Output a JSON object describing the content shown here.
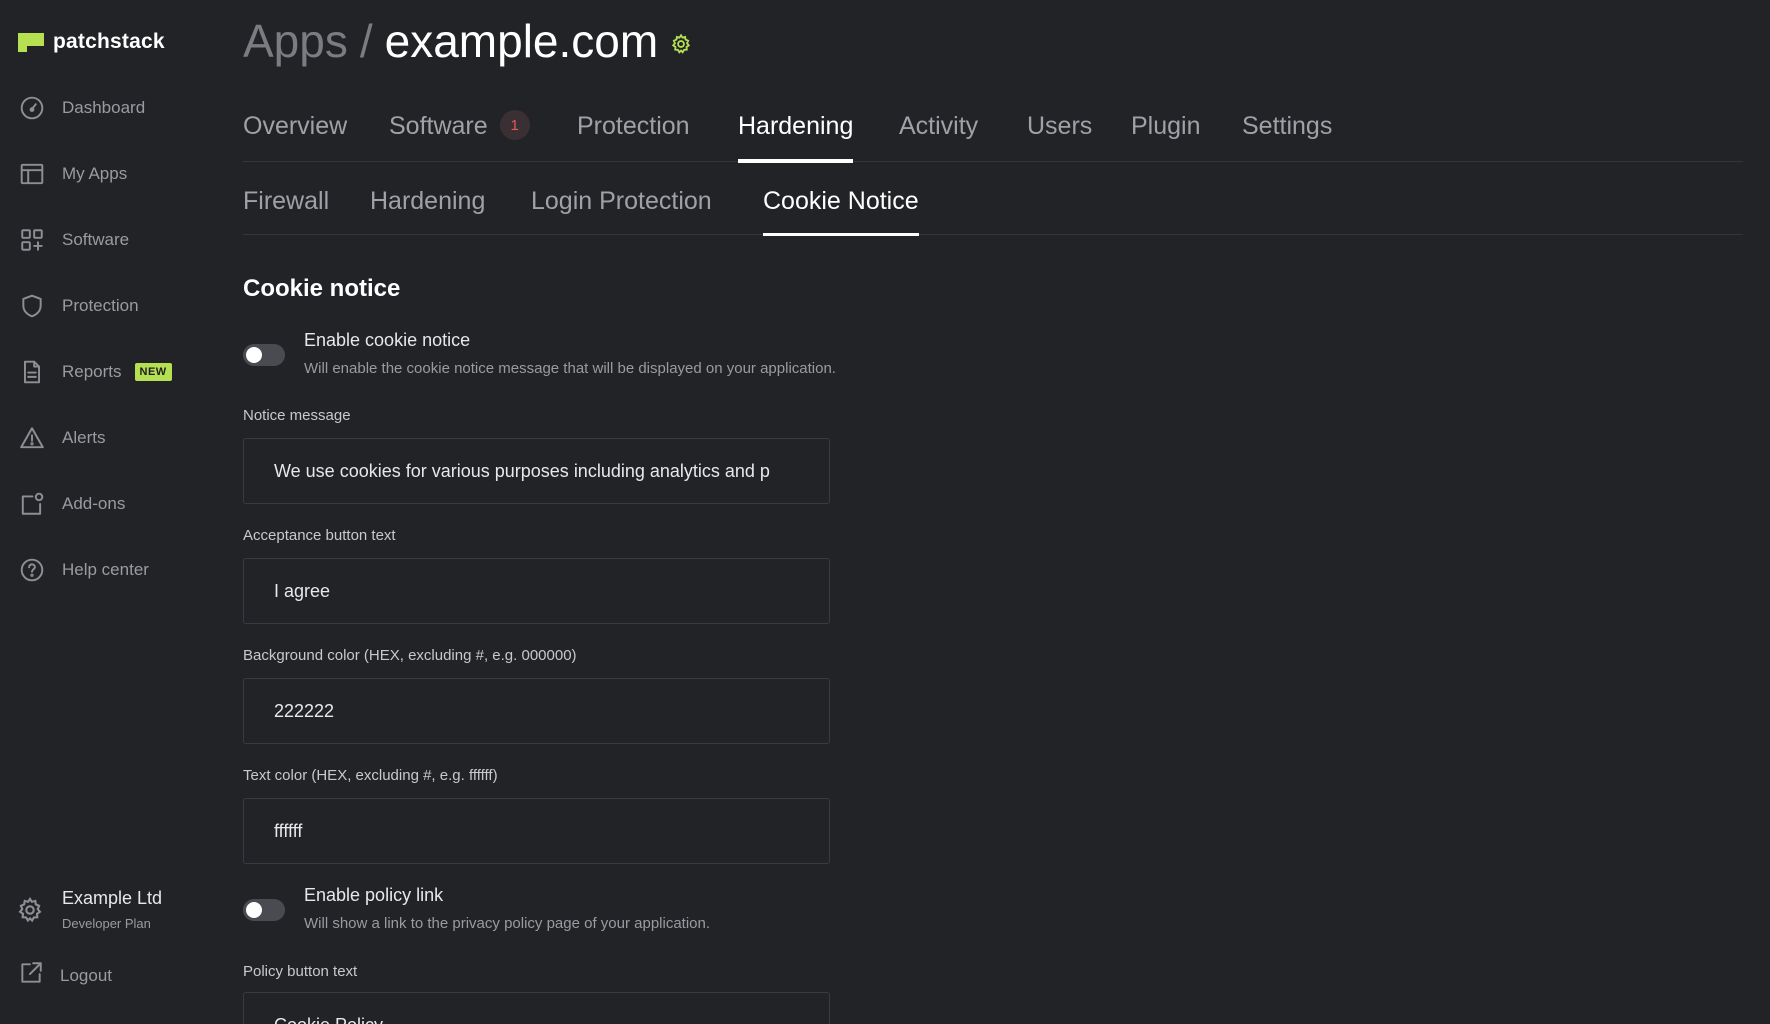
{
  "brand": {
    "name": "patchstack"
  },
  "sidebar": {
    "items": [
      {
        "label": "Dashboard",
        "icon": "dashboard-icon"
      },
      {
        "label": "My Apps",
        "icon": "apps-icon"
      },
      {
        "label": "Software",
        "icon": "software-icon"
      },
      {
        "label": "Protection",
        "icon": "shield-icon"
      },
      {
        "label": "Reports",
        "icon": "report-icon",
        "badge": "NEW"
      },
      {
        "label": "Alerts",
        "icon": "alert-icon"
      },
      {
        "label": "Add-ons",
        "icon": "addons-icon"
      },
      {
        "label": "Help center",
        "icon": "help-icon"
      }
    ],
    "account": {
      "name": "Example Ltd",
      "plan": "Developer Plan",
      "icon": "gear-icon"
    },
    "logout": {
      "label": "Logout",
      "icon": "logout-icon"
    }
  },
  "header": {
    "breadcrumb_root": "Apps",
    "separator": "/",
    "title": "example.com",
    "settings_icon": "gear-icon"
  },
  "tabs": [
    {
      "label": "Overview"
    },
    {
      "label": "Software",
      "count": "1"
    },
    {
      "label": "Protection"
    },
    {
      "label": "Hardening",
      "active": true
    },
    {
      "label": "Activity"
    },
    {
      "label": "Users"
    },
    {
      "label": "Plugin"
    },
    {
      "label": "Settings"
    }
  ],
  "subtabs": [
    {
      "label": "Firewall"
    },
    {
      "label": "Hardening"
    },
    {
      "label": "Login Protection"
    },
    {
      "label": "Cookie Notice",
      "active": true
    }
  ],
  "cookie": {
    "section_title": "Cookie notice",
    "enable_notice": {
      "label": "Enable cookie notice",
      "description": "Will enable the cookie notice message that will be displayed on your application.",
      "enabled": false
    },
    "notice_message": {
      "label": "Notice message",
      "value": "We use cookies for various purposes including analytics and p"
    },
    "acceptance_button": {
      "label": "Acceptance button text",
      "value": "I agree"
    },
    "background_color": {
      "label": "Background color (HEX, excluding #, e.g. 000000)",
      "value": "222222"
    },
    "text_color": {
      "label": "Text color (HEX, excluding #, e.g. ffffff)",
      "value": "ffffff"
    },
    "enable_policy": {
      "label": "Enable policy link",
      "description": "Will show a link to the privacy policy page of your application.",
      "enabled": false
    },
    "policy_button": {
      "label": "Policy button text",
      "value": "Cookie Policy"
    }
  },
  "colors": {
    "background": "#222327",
    "accent": "#b5e051",
    "badge_count": "#e05a5a"
  }
}
